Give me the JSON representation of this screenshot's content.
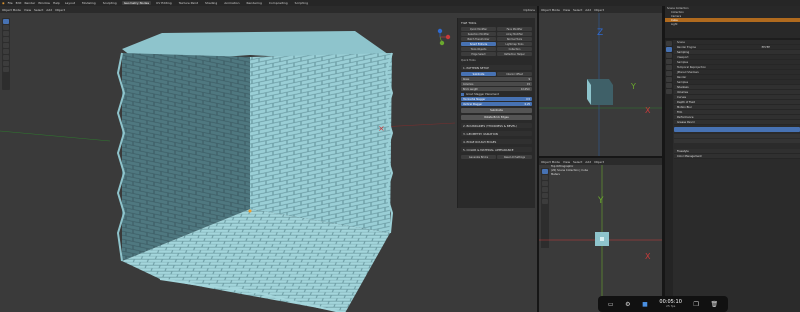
{
  "topbar": {
    "menus": [
      "File",
      "Edit",
      "Render",
      "Window",
      "Help"
    ],
    "workspaces": [
      "Layout",
      "Modeling",
      "Sculpting",
      "UV Editing",
      "Texture Paint",
      "Shading",
      "Animation",
      "Rendering",
      "Compositing",
      "Geometry Nodes",
      "Scripting"
    ],
    "active_workspace": "Geometry Nodes"
  },
  "main_viewport": {
    "header": [
      "Object Mode",
      "View",
      "Select",
      "Add",
      "Object"
    ],
    "options": "Options"
  },
  "npanel": {
    "title": "TILE TOOL",
    "buttons": [
      "Quick Modifier",
      "Face Modifier",
      "Selection Modifier",
      "Array Modifier",
      "Batch Transformer",
      "Normal Tools",
      "Smart Extrude",
      "Lightmap Tools",
      "Tools Objects",
      "Collection",
      "Edge Select",
      "Reflection Helper"
    ],
    "active_button": "Smart Extrude",
    "subtitle": "Quick Tools",
    "section1": "1. PATTERN SETUP",
    "tabs": [
      "Subdivide",
      "Interior Offset"
    ],
    "rows": [
      {
        "label": "Rows",
        "value": "9"
      },
      {
        "label": "Columns",
        "value": "15"
      },
      {
        "label": "Brick Length",
        "value": "0.125m"
      }
    ],
    "checkbox": "Grout Stagger Placement",
    "blue_rows": [
      {
        "label": "Horizontal Stagger",
        "value": "0.5"
      },
      {
        "label": "Vertical Stagger",
        "value": "0.25"
      }
    ],
    "btn1": "Subdivide",
    "btn2": "Rotate Brick Edges",
    "sections": [
      "2. BOUNDARIES (THICKNESS & BEVEL)",
      "3. GEOMETRY VARIATION",
      "4. EDGE ROUGH EDGES",
      "5. COLOR & MATERIAL APPEARANCE"
    ],
    "footer_buttons": [
      "Generate Bricks",
      "Reset All Settings"
    ]
  },
  "side_viewport": {
    "header": [
      "Object Mode",
      "View",
      "Select",
      "Add",
      "Object"
    ],
    "options": "Options"
  },
  "side_viewport2": {
    "header": [
      "Object Mode",
      "View",
      "Select",
      "Add",
      "Object"
    ],
    "text_lines": [
      "Top Orthographic",
      "(20) Scene Collection | Cube",
      "Meters"
    ]
  },
  "outliner": {
    "title": "Scene Collection",
    "items": [
      "Collection",
      "Camera",
      "Cube",
      "Light"
    ],
    "selected": "Cube"
  },
  "properties": {
    "object": "Scene",
    "render_engine_label": "Render Engine",
    "render_engine": "EEVEE",
    "rows": [
      "Sampling",
      "Viewport",
      "Samples",
      "Temporal Reprojection",
      "Jittered Shadows",
      "Render",
      "Samples",
      "Shadows",
      "Volumes",
      "Curves",
      "Depth of Field",
      "Motion Blur",
      "Film",
      "Performance",
      "Grease Pencil",
      "Freestyle",
      "Color Management"
    ]
  },
  "dock": {
    "time": "00:05:10",
    "fps": "25 fps"
  },
  "colors": {
    "accent": "#4772b3",
    "brick": "#8ec4cc",
    "brick_dark": "#4a6a72",
    "selected_row": "#b06a1e"
  }
}
